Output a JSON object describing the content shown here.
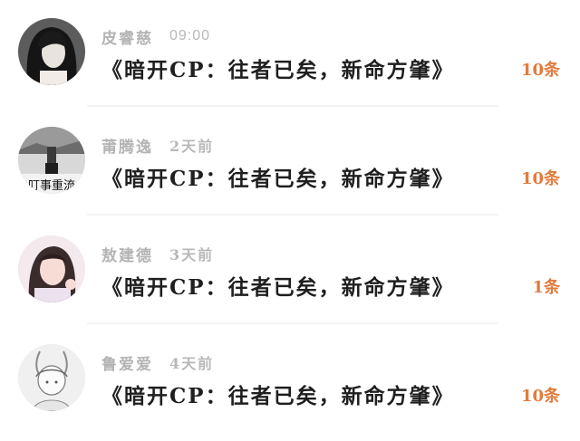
{
  "messages": [
    {
      "name": "皮睿慈",
      "time": "09:00",
      "title": "《暗开CP：往者已矣，新命方肇》",
      "count": "10条"
    },
    {
      "name": "莆腾逸",
      "time": "2天前",
      "title": "《暗开CP：往者已矣，新命方肇》",
      "count": "10条",
      "avatar_text": "叮事重流"
    },
    {
      "name": "敖建德",
      "time": "3天前",
      "title": "《暗开CP：往者已矣，新命方肇》",
      "count": "1条"
    },
    {
      "name": "鲁爱爱",
      "time": "4天前",
      "title": "《暗开CP：往者已矣，新命方肇》",
      "count": "10条"
    }
  ],
  "colors": {
    "accent": "#e37b3c",
    "name": "#b4b4b4",
    "title": "#1f1f1f",
    "divider": "#f3f3f3"
  }
}
